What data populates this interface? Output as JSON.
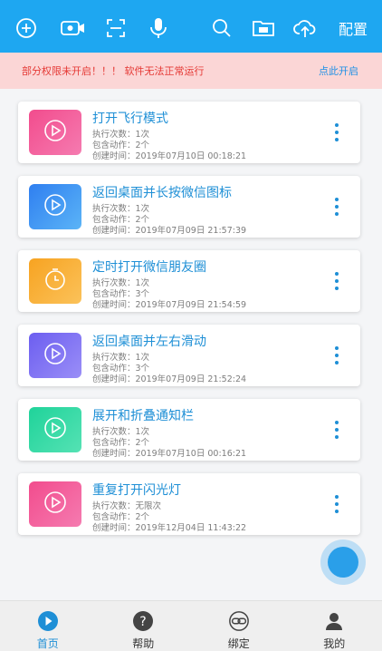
{
  "toolbar": {
    "config_label": "配置",
    "icons": [
      "add-icon",
      "video-icon",
      "scan-icon",
      "mic-icon",
      "search-icon",
      "folder-icon",
      "cloud-upload-icon"
    ]
  },
  "warning": {
    "text": "部分权限未开启！！！ 软件无法正常运行",
    "link": "点此开启"
  },
  "tasks": [
    {
      "title": "打开飞行模式",
      "exec": "执行次数：1次",
      "actions": "包含动作：2个",
      "created": "创建时间：2019年07月10日 00:18:21",
      "icon": "play-icon",
      "color_start": "#f24c8d",
      "color_end": "#f57bb0"
    },
    {
      "title": "返回桌面并长按微信图标",
      "exec": "执行次数：1次",
      "actions": "包含动作：2个",
      "created": "创建时间：2019年07月09日 21:57:39",
      "icon": "play-icon",
      "color_start": "#2f7ff0",
      "color_end": "#5bb4f7"
    },
    {
      "title": "定时打开微信朋友圈",
      "exec": "执行次数：1次",
      "actions": "包含动作：3个",
      "created": "创建时间：2019年07月09日 21:54:59",
      "icon": "timer-icon",
      "color_start": "#f7a321",
      "color_end": "#fbc25a"
    },
    {
      "title": "返回桌面并左右滑动",
      "exec": "执行次数：1次",
      "actions": "包含动作：3个",
      "created": "创建时间：2019年07月09日 21:52:24",
      "icon": "play-icon",
      "color_start": "#6c5ef0",
      "color_end": "#9a8ef7"
    },
    {
      "title": "展开和折叠通知栏",
      "exec": "执行次数：1次",
      "actions": "包含动作：2个",
      "created": "创建时间：2019年07月10日 00:16:21",
      "icon": "play-icon",
      "color_start": "#1fd39a",
      "color_end": "#55e2b4"
    },
    {
      "title": "重复打开闪光灯",
      "exec": "执行次数：无限次",
      "actions": "包含动作：2个",
      "created": "创建时间：2019年12月04日 11:43:22",
      "icon": "play-icon",
      "color_start": "#f24c8d",
      "color_end": "#f57bb0"
    }
  ],
  "nav": [
    {
      "label": "首页",
      "icon": "home-play-icon",
      "active": true
    },
    {
      "label": "帮助",
      "icon": "help-icon",
      "active": false
    },
    {
      "label": "绑定",
      "icon": "link-icon",
      "active": false
    },
    {
      "label": "我的",
      "icon": "user-icon",
      "active": false
    }
  ]
}
